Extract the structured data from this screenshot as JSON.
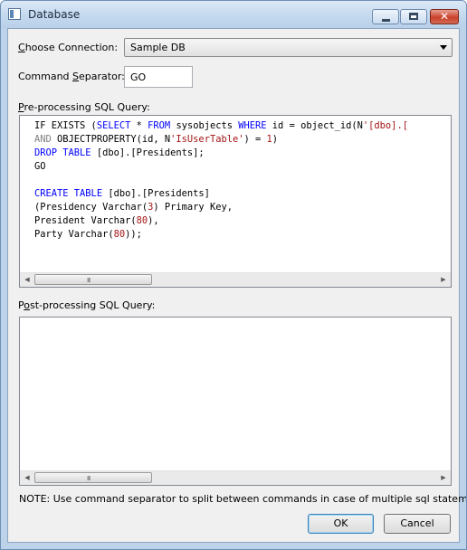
{
  "window": {
    "title": "Database"
  },
  "title_controls": {
    "close_glyph": "✕"
  },
  "connection": {
    "label": "Choose Connection:",
    "accel": "C",
    "value": "Sample DB"
  },
  "separator": {
    "label": "Command Separator:",
    "accel": "S",
    "value": "GO"
  },
  "pre_query": {
    "label": "Pre-processing SQL Query:",
    "accel": "P",
    "lines": [
      [
        [
          "t",
          "IF EXISTS ("
        ],
        [
          "kw",
          "SELECT"
        ],
        [
          "t",
          " * "
        ],
        [
          "kw",
          "FROM"
        ],
        [
          "t",
          " sysobjects "
        ],
        [
          "kw",
          "WHERE"
        ],
        [
          "t",
          " id = object_id(N"
        ],
        [
          "str",
          "'[dbo].["
        ]
      ],
      [
        [
          "gr",
          "AND"
        ],
        [
          "t",
          " OBJECTPROPERTY(id, N"
        ],
        [
          "str",
          "'IsUserTable'"
        ],
        [
          "t",
          ") = "
        ],
        [
          "str",
          "1"
        ],
        [
          "t",
          ")"
        ]
      ],
      [
        [
          "kw",
          "DROP TABLE"
        ],
        [
          "t",
          " [dbo].[Presidents];"
        ]
      ],
      [
        [
          "t",
          "GO"
        ]
      ],
      [
        [
          "t",
          ""
        ]
      ],
      [
        [
          "kw",
          "CREATE TABLE"
        ],
        [
          "t",
          " [dbo].[Presidents]"
        ]
      ],
      [
        [
          "t",
          "(Presidency Varchar("
        ],
        [
          "str",
          "3"
        ],
        [
          "t",
          ") Primary Key,"
        ]
      ],
      [
        [
          "t",
          "President Varchar("
        ],
        [
          "str",
          "80"
        ],
        [
          "t",
          "),"
        ]
      ],
      [
        [
          "t",
          "Party Varchar("
        ],
        [
          "str",
          "80"
        ],
        [
          "t",
          "));"
        ]
      ]
    ]
  },
  "post_query": {
    "label": "Post-processing SQL Query:",
    "accel": "o",
    "lines": []
  },
  "scrollbar": {
    "left_glyph": "◀",
    "right_glyph": "▶",
    "grip": "III"
  },
  "note": "NOTE: Use command separator to split between commands in case of multiple sql statements.",
  "buttons": {
    "ok": "OK",
    "cancel": "Cancel"
  }
}
